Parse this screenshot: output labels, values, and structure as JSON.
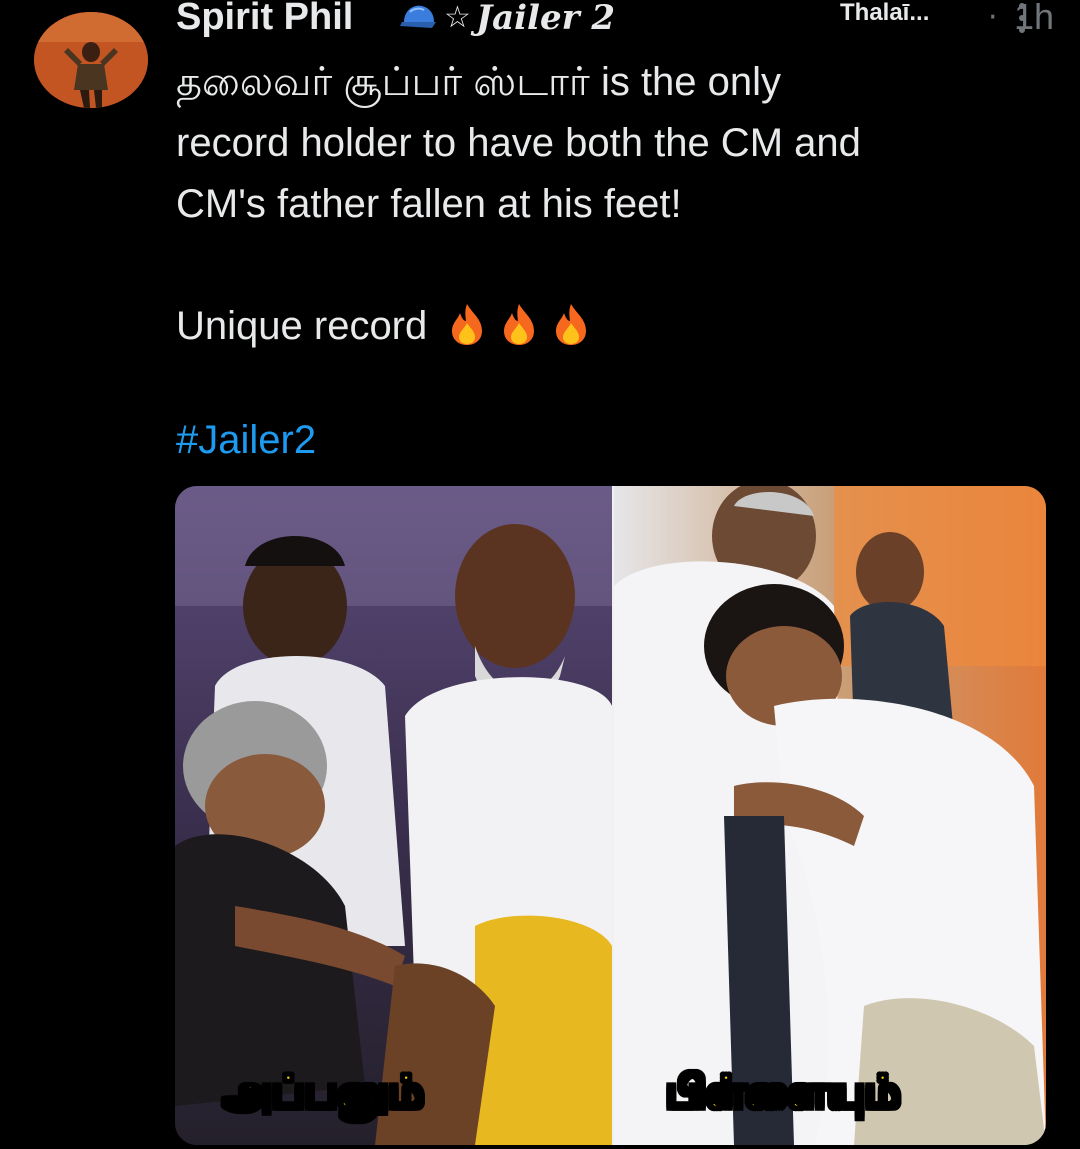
{
  "tweet": {
    "display_name": "Spirit Phil",
    "badge_text": "Jailer 2",
    "truncated_tag": "Thalaī...",
    "separator": "·",
    "timestamp": "1h",
    "text_lines": [
      "தலைவர் சூப்பர் ஸ்டார் is the only",
      "record holder to have both the CM and",
      "CM's  father fallen at his feet!"
    ],
    "closing_text": "Unique record",
    "emoji": [
      "fire-icon",
      "fire-icon",
      "fire-icon"
    ],
    "hashtag": "#Jailer2",
    "icons": {
      "verified_badge": "blue-cap-icon",
      "star": "star-icon",
      "grok": "grok-slash-icon",
      "more": "more-vertical-icon"
    }
  },
  "media": {
    "left_caption": "அப்பனும்",
    "right_caption": "பிள்ளையும்"
  },
  "colors": {
    "background": "#000000",
    "text": "#e7e9ea",
    "muted": "#71767b",
    "link": "#1d9bf0",
    "caption": "#ffd500"
  }
}
